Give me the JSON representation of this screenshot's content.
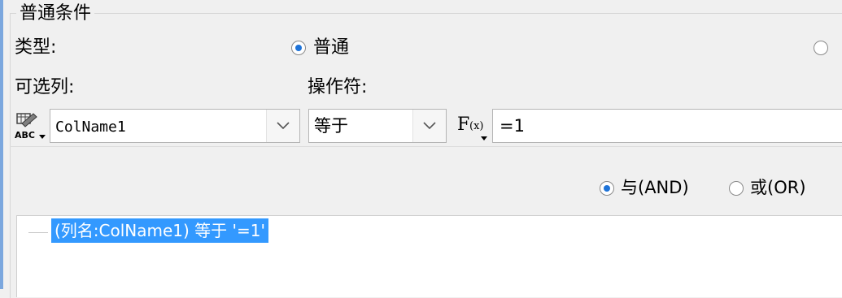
{
  "group": {
    "title": "普通条件"
  },
  "type_row": {
    "label": "类型:",
    "options": [
      {
        "label": "普通",
        "checked": true
      },
      {
        "label": "",
        "checked": false
      }
    ]
  },
  "column": {
    "label": "可选列:",
    "value": "ColName1",
    "icon": "abc-column-icon"
  },
  "operator": {
    "label": "操作符:",
    "value": "等于"
  },
  "value_field": {
    "value": "=1",
    "icon": "formula-fx-icon"
  },
  "logic": {
    "options": [
      {
        "label": "与(AND)",
        "checked": true
      },
      {
        "label": "或(OR)",
        "checked": false
      }
    ]
  },
  "condition_tree": {
    "items": [
      {
        "text": "(列名:ColName1) 等于 '=1'",
        "selected": true
      }
    ]
  },
  "colors": {
    "selection": "#3399ff",
    "radio_dot": "#1e73d8",
    "accent": "#7ba7de"
  }
}
